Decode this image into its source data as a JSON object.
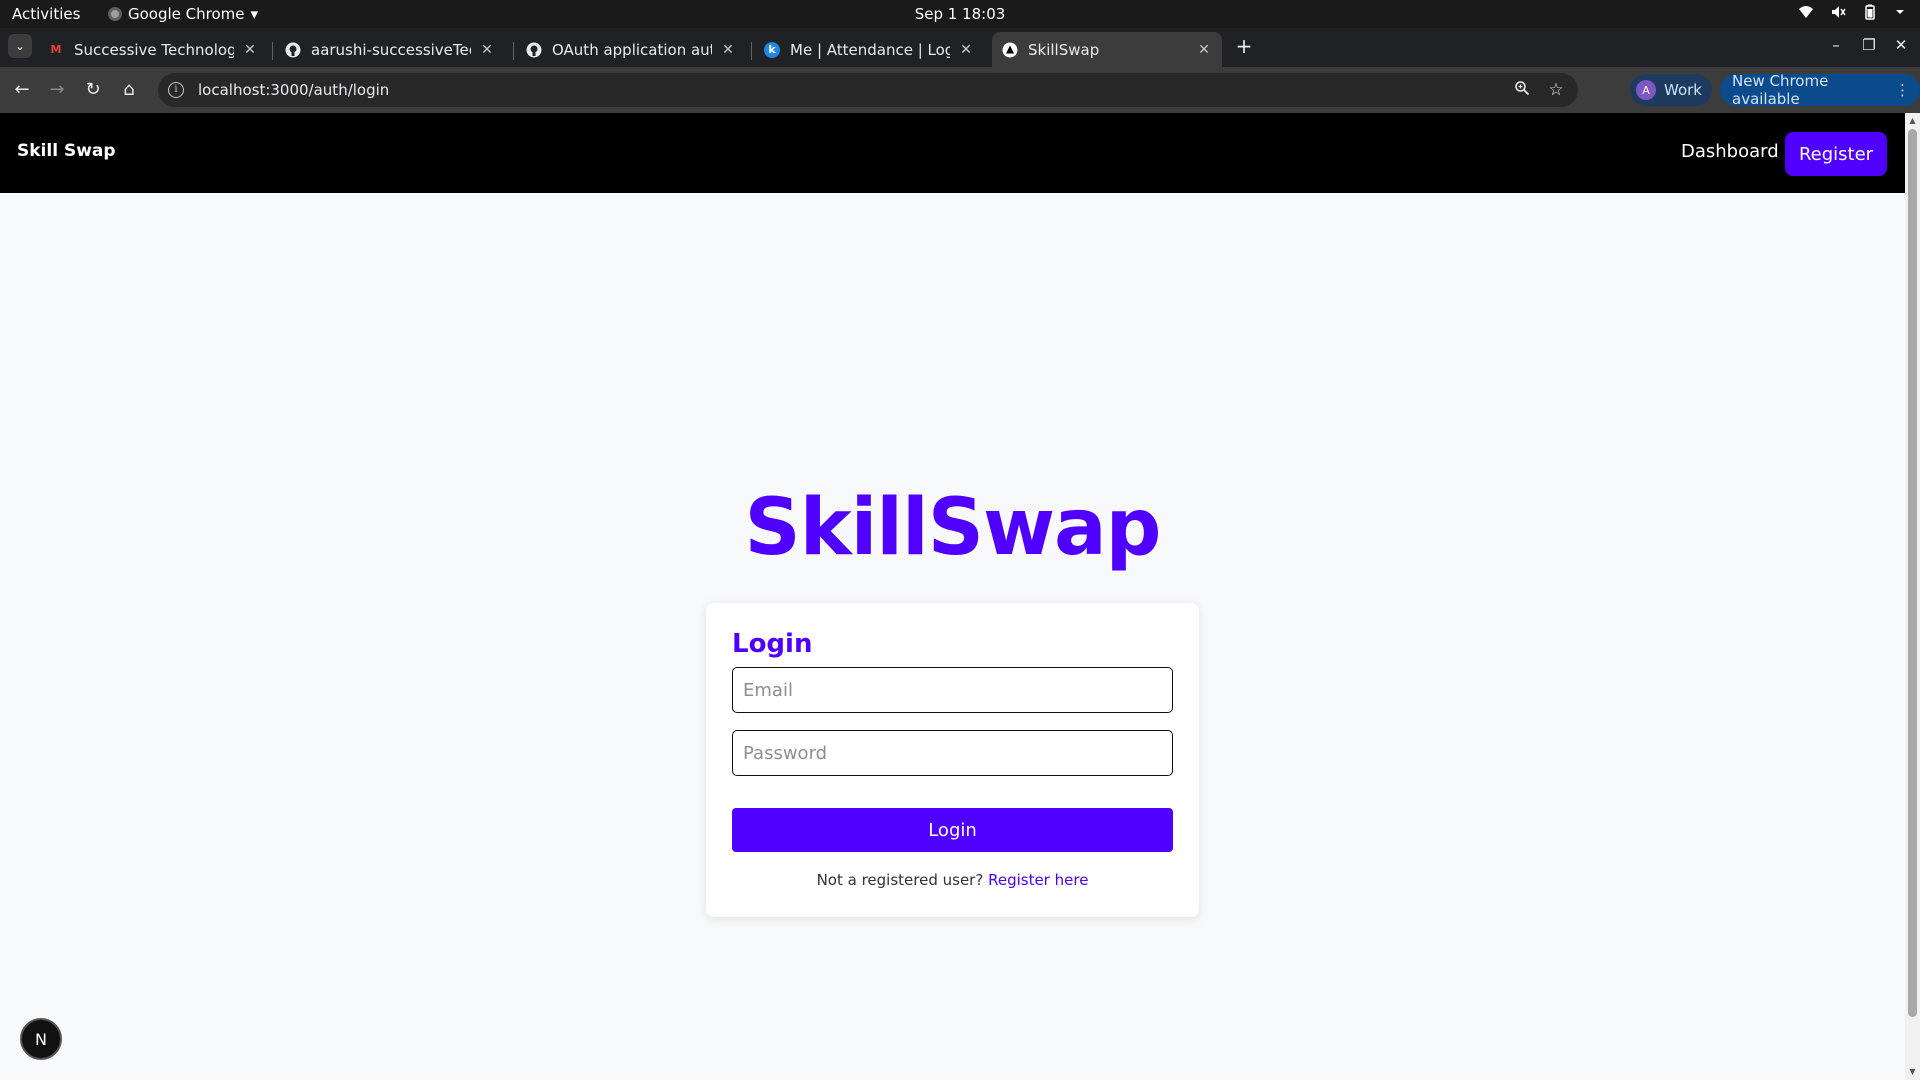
{
  "system": {
    "activities": "Activities",
    "app_name": "Google Chrome",
    "app_menu_arrow": "▾",
    "clock": "Sep 1  18:03",
    "status_icons": [
      "wifi-icon",
      "volume-muted-icon",
      "battery-icon",
      "system-menu-icon"
    ]
  },
  "browser": {
    "tabs": [
      {
        "title": "Successive Technologies",
        "favicon": "gmail-icon"
      },
      {
        "title": "aarushi-successiveTech/s",
        "favicon": "github-icon"
      },
      {
        "title": "OAuth application autho",
        "favicon": "github-icon"
      },
      {
        "title": "Me | Attendance | Logs",
        "favicon": "keka-icon"
      },
      {
        "title": "SkillSwap",
        "favicon": "nextjs-icon",
        "active": true
      }
    ],
    "url": "localhost:3000/auth/login",
    "profile_initial": "A",
    "profile_label": "Work",
    "update_label": "New Chrome available"
  },
  "app": {
    "brand": "Skill Swap",
    "nav_dashboard": "Dashboard",
    "nav_register": "Register",
    "hero_title": "SkillSwap",
    "login": {
      "title": "Login",
      "email_placeholder": "Email",
      "email_value": "",
      "password_placeholder": "Password",
      "password_value": "",
      "button_label": "Login",
      "footer_text": "Not a registered user?",
      "register_link": "Register here"
    },
    "dev_badge": "N"
  },
  "colors": {
    "accent": "#4f00ff",
    "navbar_bg": "#000000",
    "page_bg": "#f8f9fb"
  }
}
